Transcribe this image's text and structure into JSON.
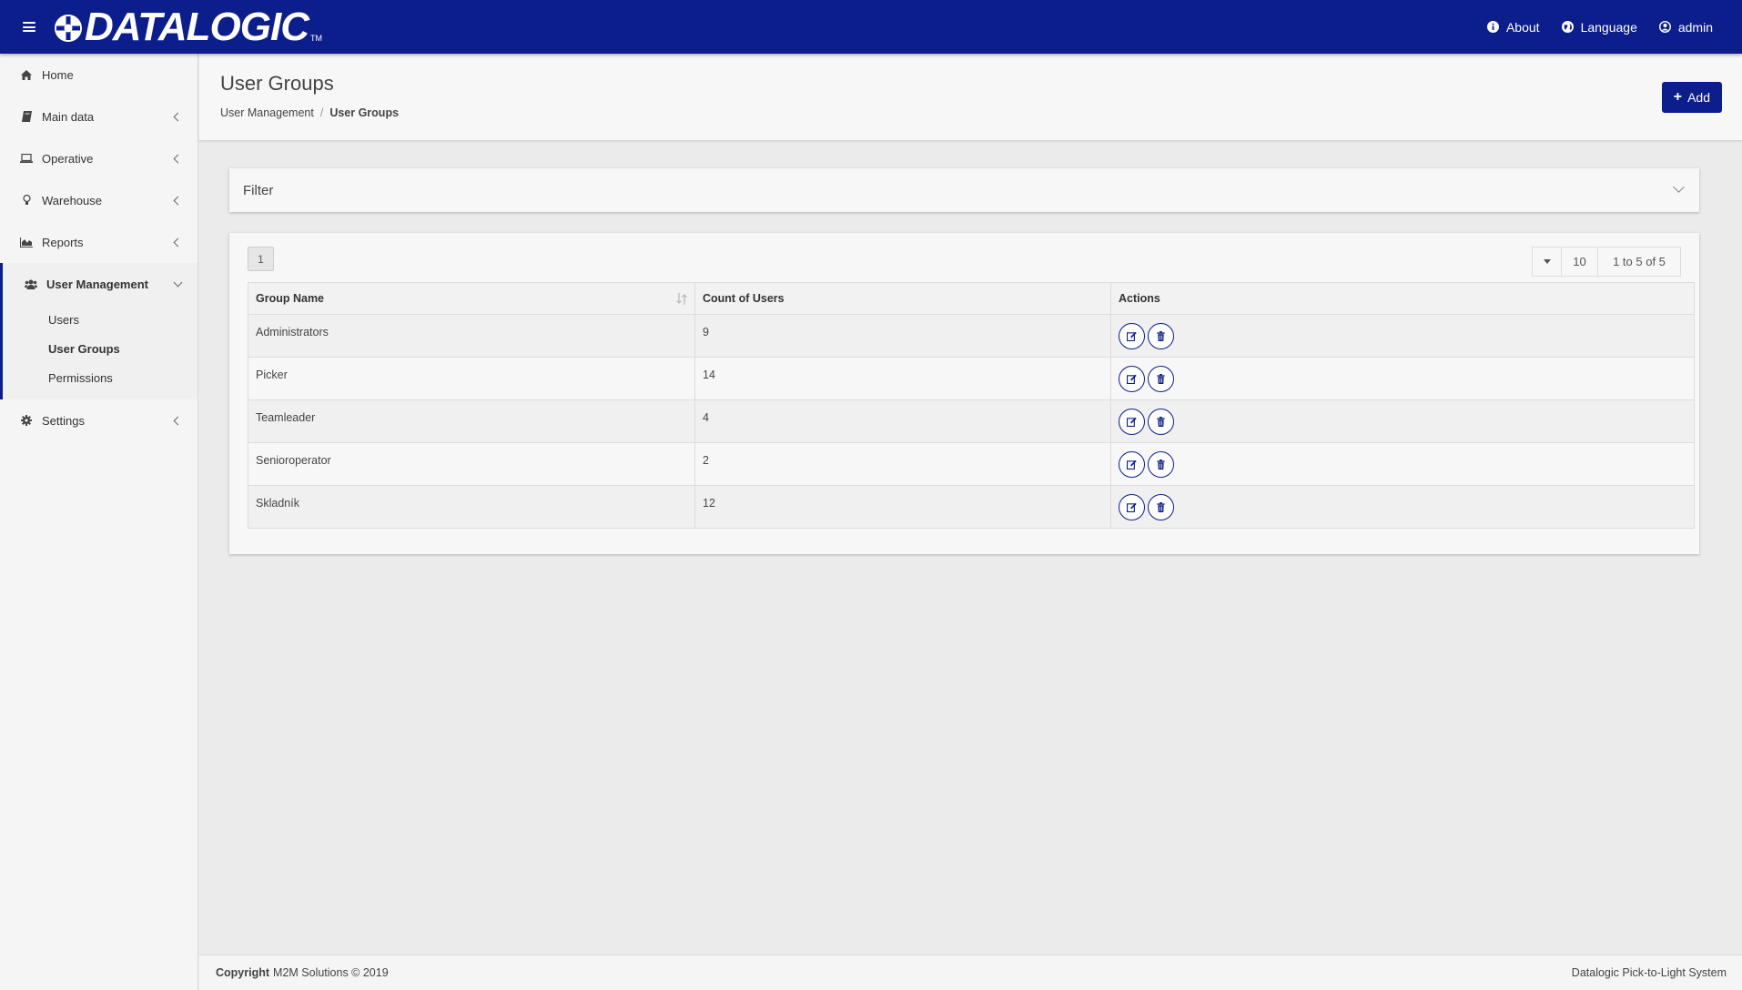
{
  "header": {
    "logo_text": "DATALOGIC",
    "logo_tm": "TM",
    "about": "About",
    "language": "Language",
    "user": "admin"
  },
  "sidebar": {
    "items": [
      {
        "label": "Home",
        "icon": "home-icon"
      },
      {
        "label": "Main data",
        "icon": "book-icon"
      },
      {
        "label": "Operative",
        "icon": "laptop-icon"
      },
      {
        "label": "Warehouse",
        "icon": "lightbulb-icon"
      },
      {
        "label": "Reports",
        "icon": "area-chart-icon"
      },
      {
        "label": "User Management",
        "icon": "users-icon"
      },
      {
        "label": "Settings",
        "icon": "gear-icon"
      }
    ],
    "user_management_sub": [
      "Users",
      "User Groups",
      "Permissions"
    ]
  },
  "page": {
    "title": "User Groups",
    "breadcrumb": [
      "User Management",
      "User Groups"
    ],
    "add_label": "Add"
  },
  "filter": {
    "label": "Filter"
  },
  "table": {
    "page_number": "1",
    "page_size": "10",
    "range_info": "1 to 5 of 5",
    "columns": [
      "Group Name",
      "Count of Users",
      "Actions"
    ],
    "rows": [
      {
        "name": "Administrators",
        "count": "9"
      },
      {
        "name": "Picker",
        "count": "14"
      },
      {
        "name": "Teamleader",
        "count": "4"
      },
      {
        "name": "Senioroperator",
        "count": "2"
      },
      {
        "name": "Skladník",
        "count": "12"
      }
    ]
  },
  "footer": {
    "copyright_label": "Copyright",
    "copyright_text": "M2M Solutions © 2019",
    "right": "Datalogic Pick-to-Light System"
  },
  "colors": {
    "brand": "#0c1d8c",
    "background": "#ebebeb",
    "panel": "#f7f7f7"
  }
}
